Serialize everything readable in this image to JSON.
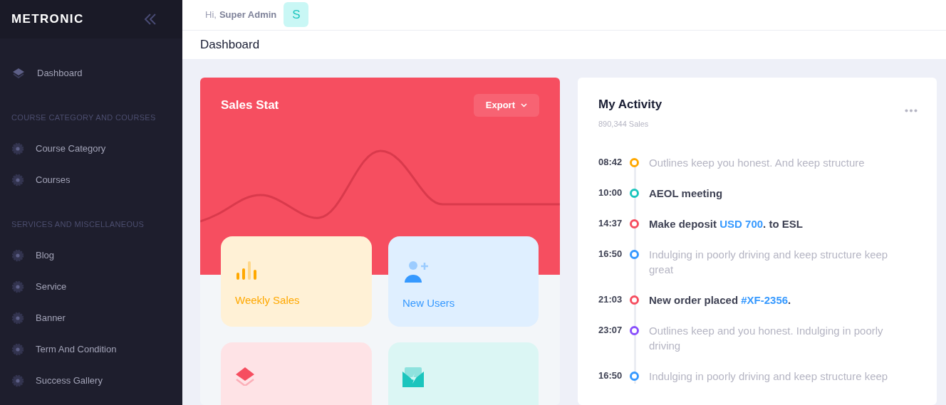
{
  "brand": {
    "name": "METRONIC"
  },
  "sidebar": {
    "items": [
      {
        "kind": "primary",
        "label": "Dashboard"
      },
      {
        "kind": "section",
        "label": "COURSE CATEGORY AND COURSES"
      },
      {
        "kind": "link",
        "label": "Course Category"
      },
      {
        "kind": "link",
        "label": "Courses"
      },
      {
        "kind": "section",
        "label": "SERVICES AND MISCELLANEOUS"
      },
      {
        "kind": "link",
        "label": "Blog"
      },
      {
        "kind": "link",
        "label": "Service"
      },
      {
        "kind": "link",
        "label": "Banner"
      },
      {
        "kind": "link",
        "label": "Term And Condition"
      },
      {
        "kind": "link",
        "label": "Success Gallery"
      }
    ]
  },
  "header": {
    "greeting": "Hi,",
    "user": "Super Admin",
    "avatar": "S"
  },
  "subheader": {
    "title": "Dashboard"
  },
  "sales_stat": {
    "title": "Sales Stat",
    "export_button": "Export",
    "tiles": [
      {
        "kind": "chart",
        "label": "Weekly Sales",
        "color": "#ffa800"
      },
      {
        "kind": "users",
        "label": "New Users",
        "color": "#3699ff"
      },
      {
        "kind": "layers",
        "color": "#f64e60"
      },
      {
        "kind": "mail",
        "color": "#1bc5bd"
      }
    ]
  },
  "activity": {
    "title": "My Activity",
    "subtitle": "890,344 Sales",
    "items": [
      {
        "time": "08:42",
        "color": "#ffa800",
        "kind": "muted",
        "parts": [
          {
            "text": "Outlines keep you honest. And keep structure"
          }
        ]
      },
      {
        "time": "10:00",
        "color": "#1bc5bd",
        "kind": "strong",
        "parts": [
          {
            "text": "AEOL meeting"
          }
        ]
      },
      {
        "time": "14:37",
        "color": "#f64e60",
        "kind": "strong",
        "parts": [
          {
            "text": "Make deposit "
          },
          {
            "text": "USD 700",
            "link": true
          },
          {
            "text": ". to ESL"
          }
        ]
      },
      {
        "time": "16:50",
        "color": "#3699ff",
        "kind": "muted",
        "parts": [
          {
            "text": "Indulging in poorly driving and keep structure keep great"
          }
        ]
      },
      {
        "time": "21:03",
        "color": "#f64e60",
        "kind": "strong",
        "parts": [
          {
            "text": "New order placed "
          },
          {
            "text": "#XF-2356",
            "link": true
          },
          {
            "text": "."
          }
        ]
      },
      {
        "time": "23:07",
        "color": "#8950fc",
        "kind": "muted",
        "parts": [
          {
            "text": "Outlines keep and you honest. Indulging in poorly driving"
          }
        ]
      },
      {
        "time": "16:50",
        "color": "#3699ff",
        "kind": "muted",
        "parts": [
          {
            "text": "Indulging in poorly driving and keep structure keep"
          }
        ]
      }
    ]
  }
}
